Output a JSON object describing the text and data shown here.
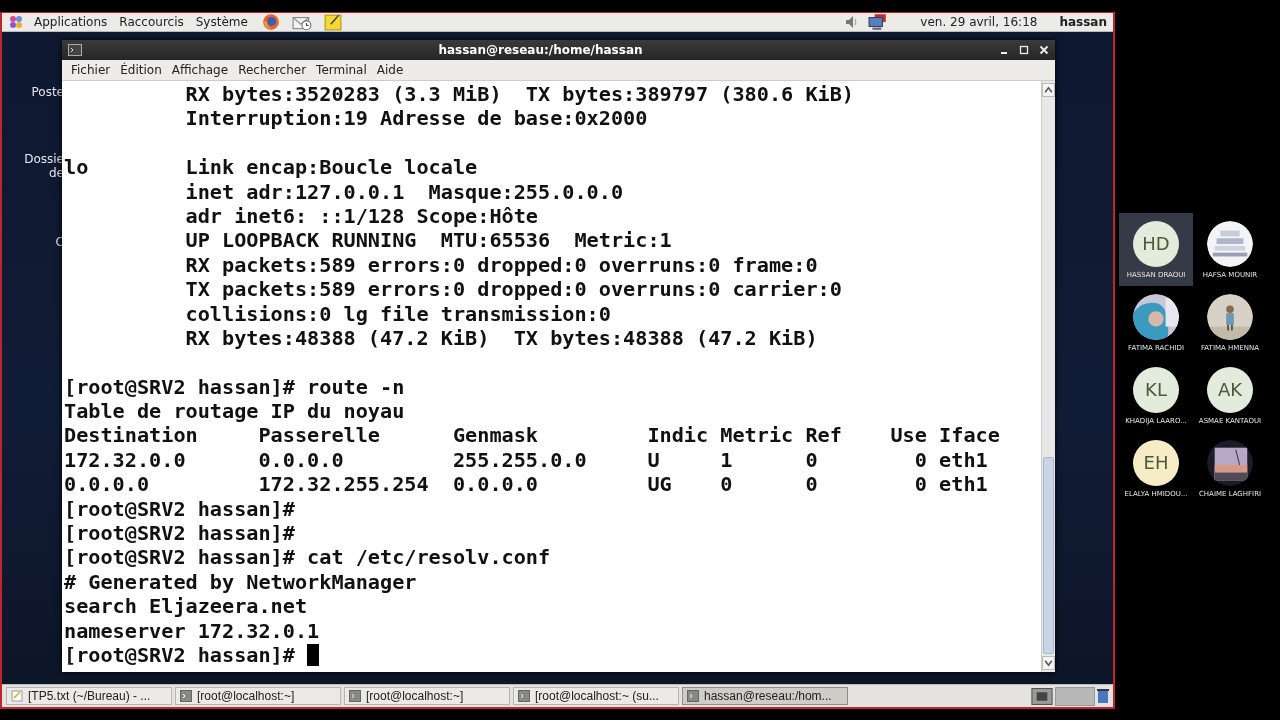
{
  "top_panel": {
    "menus": [
      "Applications",
      "Raccourcis",
      "Système"
    ],
    "clock": "ven. 29 avril, 16:18",
    "user": "hassan"
  },
  "desktop_labels": [
    "Poste",
    "Dossie",
    "de",
    "C"
  ],
  "window": {
    "title": "hassan@reseau:/home/hassan",
    "menu": [
      "Fichier",
      "Édition",
      "Affichage",
      "Rechercher",
      "Terminal",
      "Aide"
    ],
    "lines": [
      {
        "text": "          RX bytes:3520283 (3.3 MiB)  TX bytes:389797 (380.6 KiB)"
      },
      {
        "text": "          Interruption:19 Adresse de base:0x2000"
      },
      {
        "text": "lo        Link encap:Boucle locale",
        "space_before": true
      },
      {
        "text": "          inet adr:127.0.0.1  Masque:255.0.0.0"
      },
      {
        "text": "          adr inet6: ::1/128 Scope:Hôte"
      },
      {
        "text": "          UP LOOPBACK RUNNING  MTU:65536  Metric:1"
      },
      {
        "text": "          RX packets:589 errors:0 dropped:0 overruns:0 frame:0"
      },
      {
        "text": "          TX packets:589 errors:0 dropped:0 overruns:0 carrier:0"
      },
      {
        "text": "          collisions:0 lg file transmission:0"
      },
      {
        "text": "          RX bytes:48388 (47.2 KiB)  TX bytes:48388 (47.2 KiB)"
      },
      {
        "text": "[root@SRV2 hassan]# route -n",
        "space_before": true
      },
      {
        "text": "Table de routage IP du noyau"
      },
      {
        "text": "Destination     Passerelle      Genmask         Indic Metric Ref    Use Iface"
      },
      {
        "text": "172.32.0.0      0.0.0.0         255.255.0.0     U     1      0        0 eth1"
      },
      {
        "text": "0.0.0.0         172.32.255.254  0.0.0.0         UG    0      0        0 eth1"
      },
      {
        "text": "[root@SRV2 hassan]#"
      },
      {
        "text": "[root@SRV2 hassan]#"
      },
      {
        "text": "[root@SRV2 hassan]# cat /etc/resolv.conf"
      },
      {
        "text": "# Generated by NetworkManager"
      },
      {
        "text": "search Eljazeera.net"
      },
      {
        "text": "nameserver 172.32.0.1"
      },
      {
        "text": "[root@SRV2 hassan]# ",
        "cursor": true
      }
    ]
  },
  "taskbar": [
    {
      "label": "[TP5.txt (~/Bureau) - ...",
      "kind": "editor",
      "selected": false
    },
    {
      "label": "[root@localhost:~]",
      "kind": "terminal",
      "selected": false
    },
    {
      "label": "[root@localhost:~]",
      "kind": "terminal",
      "selected": false
    },
    {
      "label": "[root@localhost:~ (su...",
      "kind": "terminal",
      "selected": false
    },
    {
      "label": "hassan@reseau:/hom...",
      "kind": "terminal",
      "selected": true
    }
  ],
  "participants": [
    {
      "name": "HASSAN DRAOUI",
      "initials": "HD",
      "color": "#e3ebdc",
      "selected": true
    },
    {
      "name": "HAFSA MOUNIR",
      "kind": "picture",
      "selected": false
    },
    {
      "name": "FATIMA RACHIDI",
      "kind": "picture",
      "selected": false
    },
    {
      "name": "FATIMA HMENNA",
      "kind": "picture",
      "selected": false
    },
    {
      "name": "KHADIJA LAARO...",
      "initials": "KL",
      "color": "#e3ebdc",
      "selected": false
    },
    {
      "name": "ASMAE KANTAOUI",
      "initials": "AK",
      "color": "#e3ebdc",
      "selected": false
    },
    {
      "name": "ELALYA HMIDOU...",
      "initials": "EH",
      "color": "#f6ecc6",
      "selected": false
    },
    {
      "name": "CHAIME LAGHFIRI",
      "kind": "picture",
      "selected": false
    }
  ]
}
